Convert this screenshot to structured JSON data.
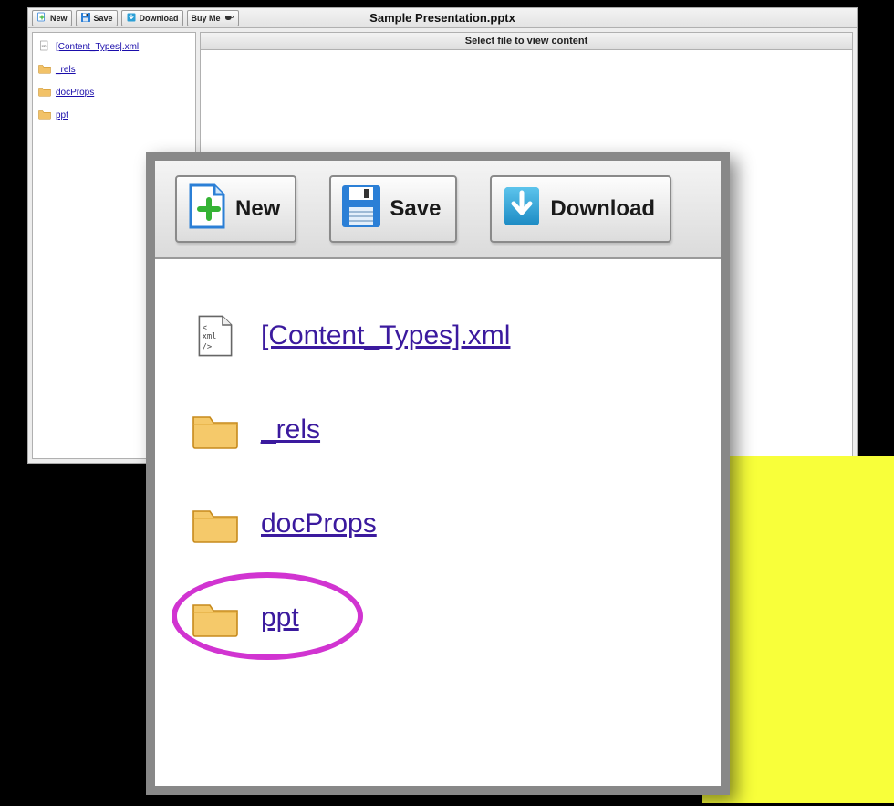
{
  "window": {
    "title": "Sample Presentation.pptx",
    "content_header": "Select file to view content"
  },
  "toolbar": {
    "new_label": "New",
    "save_label": "Save",
    "download_label": "Download",
    "buyme_label": "Buy Me"
  },
  "tree": {
    "items": [
      {
        "label": "[Content_Types].xml",
        "type": "xml"
      },
      {
        "label": "_rels",
        "type": "folder"
      },
      {
        "label": "docProps",
        "type": "folder"
      },
      {
        "label": "ppt",
        "type": "folder",
        "highlighted": true
      }
    ]
  }
}
